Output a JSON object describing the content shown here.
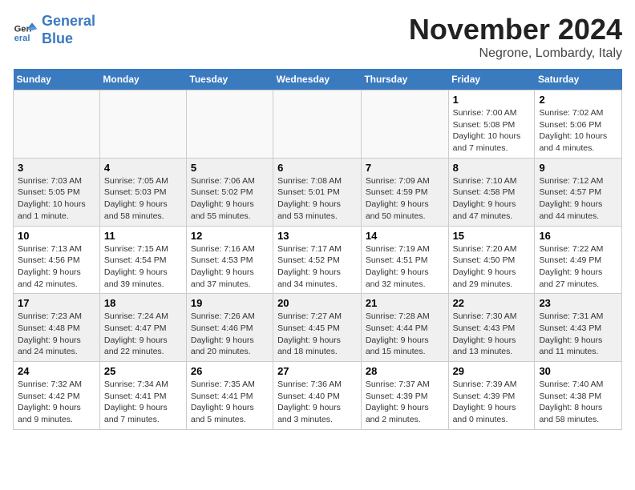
{
  "header": {
    "logo_line1": "General",
    "logo_line2": "Blue",
    "month": "November 2024",
    "location": "Negrone, Lombardy, Italy"
  },
  "weekdays": [
    "Sunday",
    "Monday",
    "Tuesday",
    "Wednesday",
    "Thursday",
    "Friday",
    "Saturday"
  ],
  "weeks": [
    [
      {
        "day": "",
        "info": ""
      },
      {
        "day": "",
        "info": ""
      },
      {
        "day": "",
        "info": ""
      },
      {
        "day": "",
        "info": ""
      },
      {
        "day": "",
        "info": ""
      },
      {
        "day": "1",
        "info": "Sunrise: 7:00 AM\nSunset: 5:08 PM\nDaylight: 10 hours\nand 7 minutes."
      },
      {
        "day": "2",
        "info": "Sunrise: 7:02 AM\nSunset: 5:06 PM\nDaylight: 10 hours\nand 4 minutes."
      }
    ],
    [
      {
        "day": "3",
        "info": "Sunrise: 7:03 AM\nSunset: 5:05 PM\nDaylight: 10 hours\nand 1 minute."
      },
      {
        "day": "4",
        "info": "Sunrise: 7:05 AM\nSunset: 5:03 PM\nDaylight: 9 hours\nand 58 minutes."
      },
      {
        "day": "5",
        "info": "Sunrise: 7:06 AM\nSunset: 5:02 PM\nDaylight: 9 hours\nand 55 minutes."
      },
      {
        "day": "6",
        "info": "Sunrise: 7:08 AM\nSunset: 5:01 PM\nDaylight: 9 hours\nand 53 minutes."
      },
      {
        "day": "7",
        "info": "Sunrise: 7:09 AM\nSunset: 4:59 PM\nDaylight: 9 hours\nand 50 minutes."
      },
      {
        "day": "8",
        "info": "Sunrise: 7:10 AM\nSunset: 4:58 PM\nDaylight: 9 hours\nand 47 minutes."
      },
      {
        "day": "9",
        "info": "Sunrise: 7:12 AM\nSunset: 4:57 PM\nDaylight: 9 hours\nand 44 minutes."
      }
    ],
    [
      {
        "day": "10",
        "info": "Sunrise: 7:13 AM\nSunset: 4:56 PM\nDaylight: 9 hours\nand 42 minutes."
      },
      {
        "day": "11",
        "info": "Sunrise: 7:15 AM\nSunset: 4:54 PM\nDaylight: 9 hours\nand 39 minutes."
      },
      {
        "day": "12",
        "info": "Sunrise: 7:16 AM\nSunset: 4:53 PM\nDaylight: 9 hours\nand 37 minutes."
      },
      {
        "day": "13",
        "info": "Sunrise: 7:17 AM\nSunset: 4:52 PM\nDaylight: 9 hours\nand 34 minutes."
      },
      {
        "day": "14",
        "info": "Sunrise: 7:19 AM\nSunset: 4:51 PM\nDaylight: 9 hours\nand 32 minutes."
      },
      {
        "day": "15",
        "info": "Sunrise: 7:20 AM\nSunset: 4:50 PM\nDaylight: 9 hours\nand 29 minutes."
      },
      {
        "day": "16",
        "info": "Sunrise: 7:22 AM\nSunset: 4:49 PM\nDaylight: 9 hours\nand 27 minutes."
      }
    ],
    [
      {
        "day": "17",
        "info": "Sunrise: 7:23 AM\nSunset: 4:48 PM\nDaylight: 9 hours\nand 24 minutes."
      },
      {
        "day": "18",
        "info": "Sunrise: 7:24 AM\nSunset: 4:47 PM\nDaylight: 9 hours\nand 22 minutes."
      },
      {
        "day": "19",
        "info": "Sunrise: 7:26 AM\nSunset: 4:46 PM\nDaylight: 9 hours\nand 20 minutes."
      },
      {
        "day": "20",
        "info": "Sunrise: 7:27 AM\nSunset: 4:45 PM\nDaylight: 9 hours\nand 18 minutes."
      },
      {
        "day": "21",
        "info": "Sunrise: 7:28 AM\nSunset: 4:44 PM\nDaylight: 9 hours\nand 15 minutes."
      },
      {
        "day": "22",
        "info": "Sunrise: 7:30 AM\nSunset: 4:43 PM\nDaylight: 9 hours\nand 13 minutes."
      },
      {
        "day": "23",
        "info": "Sunrise: 7:31 AM\nSunset: 4:43 PM\nDaylight: 9 hours\nand 11 minutes."
      }
    ],
    [
      {
        "day": "24",
        "info": "Sunrise: 7:32 AM\nSunset: 4:42 PM\nDaylight: 9 hours\nand 9 minutes."
      },
      {
        "day": "25",
        "info": "Sunrise: 7:34 AM\nSunset: 4:41 PM\nDaylight: 9 hours\nand 7 minutes."
      },
      {
        "day": "26",
        "info": "Sunrise: 7:35 AM\nSunset: 4:41 PM\nDaylight: 9 hours\nand 5 minutes."
      },
      {
        "day": "27",
        "info": "Sunrise: 7:36 AM\nSunset: 4:40 PM\nDaylight: 9 hours\nand 3 minutes."
      },
      {
        "day": "28",
        "info": "Sunrise: 7:37 AM\nSunset: 4:39 PM\nDaylight: 9 hours\nand 2 minutes."
      },
      {
        "day": "29",
        "info": "Sunrise: 7:39 AM\nSunset: 4:39 PM\nDaylight: 9 hours\nand 0 minutes."
      },
      {
        "day": "30",
        "info": "Sunrise: 7:40 AM\nSunset: 4:38 PM\nDaylight: 8 hours\nand 58 minutes."
      }
    ]
  ]
}
